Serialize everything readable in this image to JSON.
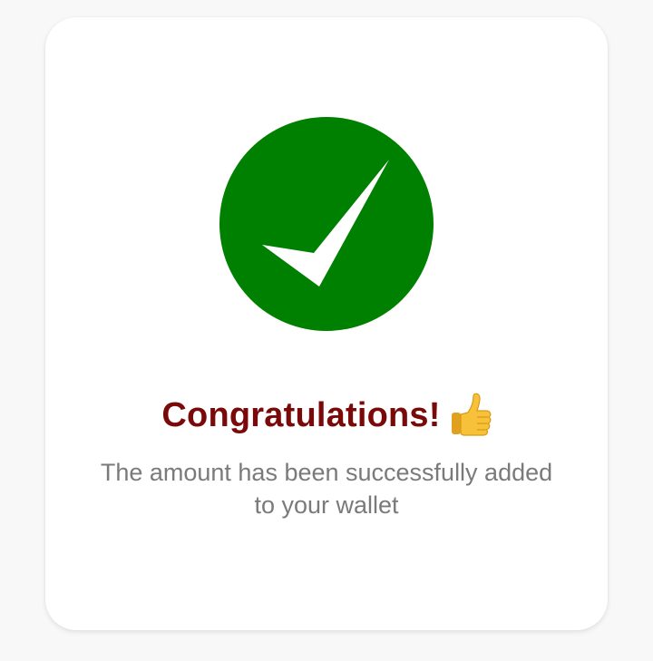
{
  "dialog": {
    "status_icon": "success-checkmark-icon",
    "title": "Congratulations!",
    "title_emoji_icon": "thumbs-up-icon",
    "message": "The amount has been successfully added to your wallet"
  },
  "colors": {
    "page_background": "#f8f8f8",
    "card_background": "#ffffff",
    "success_green": "#008000",
    "title_color": "#7a0a0a",
    "message_color": "#7a7a7a",
    "thumb_yellow": "#f7c23a"
  }
}
